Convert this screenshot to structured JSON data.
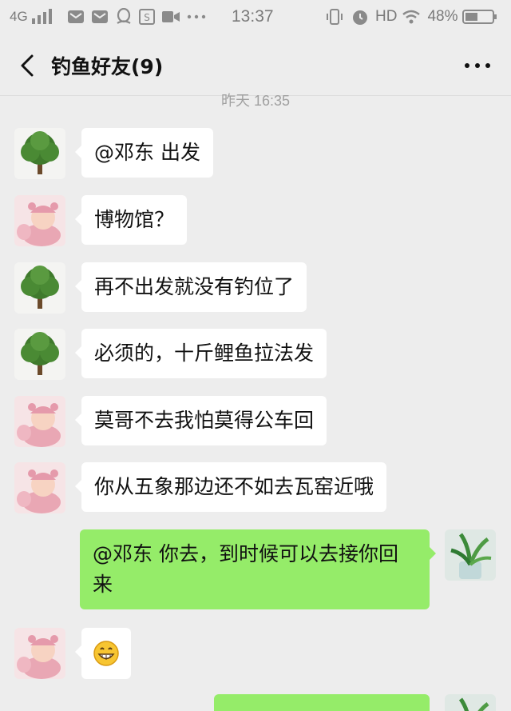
{
  "status_bar": {
    "network": "4G",
    "time": "13:37",
    "hd": "HD",
    "battery": "48%",
    "icons": [
      "signal-icon",
      "mail-icon",
      "mail-icon",
      "qq-icon",
      "app-icon",
      "video-icon",
      "more-dots-icon",
      "vibrate-icon",
      "alarm-icon",
      "wifi-icon",
      "battery-icon"
    ]
  },
  "header": {
    "title": "钓鱼好友(9)",
    "back_icon": "back-arrow-icon",
    "more_icon": "more-icon"
  },
  "chat": {
    "timestamp": "昨天 16:35",
    "messages": [
      {
        "side": "left",
        "avatar": "tree-avatar",
        "text": "@邓东  出发"
      },
      {
        "side": "left",
        "avatar": "baby-avatar",
        "text": "博物馆？"
      },
      {
        "side": "left",
        "avatar": "tree-avatar",
        "text": "再不出发就没有钓位了"
      },
      {
        "side": "left",
        "avatar": "tree-avatar",
        "text": "必须的，十斤鲤鱼拉法发"
      },
      {
        "side": "left",
        "avatar": "baby-avatar",
        "text": "莫哥不去我怕莫得公车回"
      },
      {
        "side": "left",
        "avatar": "baby-avatar",
        "text": "你从五象那边还不如去瓦窑近哦"
      },
      {
        "side": "right",
        "avatar": "plant-avatar",
        "text_line1": "@邓东  你去，到时候可以去接你回",
        "text_line2": "来"
      },
      {
        "side": "left",
        "avatar": "baby-avatar",
        "emoji": "grin-emoji"
      },
      {
        "side": "right",
        "avatar": "plant-avatar",
        "text": ""
      }
    ]
  },
  "colors": {
    "background": "#ededed",
    "incoming_bubble": "#ffffff",
    "outgoing_bubble": "#95ec69"
  }
}
